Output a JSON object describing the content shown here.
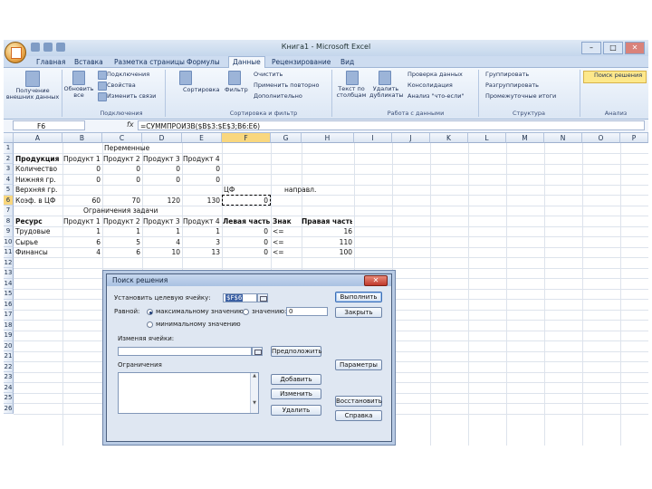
{
  "window": {
    "title": "Книга1 - Microsoft Excel"
  },
  "tabs": [
    "Главная",
    "Вставка",
    "Разметка страницы",
    "Формулы",
    "Данные",
    "Рецензирование",
    "Вид"
  ],
  "active_tab": "Данные",
  "ribbon": {
    "get_external": "Получение внешних данных",
    "refresh_all": "Обновить все",
    "connections": "Подключения",
    "properties": "Свойства",
    "edit_links": "Изменить связи",
    "group_connections": "Подключения",
    "sort": "Сортировка",
    "filter": "Фильтр",
    "clear": "Очистить",
    "reapply": "Применить повторно",
    "advanced": "Дополнительно",
    "group_sort": "Сортировка и фильтр",
    "text_to_columns": "Текст по столбцам",
    "remove_duplicates": "Удалить дубликаты",
    "data_validation": "Проверка данных",
    "consolidate": "Консолидация",
    "what_if": "Анализ \"что-если\"",
    "group_data_tools": "Работа с данными",
    "group": "Группировать",
    "ungroup": "Разгруппировать",
    "subtotal": "Промежуточные итоги",
    "group_outline": "Структура",
    "solver": "Поиск решения",
    "group_analysis": "Анализ"
  },
  "formula_bar": {
    "name_box": "F6",
    "fx": "fx",
    "formula": "=СУММПРОИЗВ($B$3:$E$3;B6:E6)"
  },
  "columns": [
    "A",
    "B",
    "C",
    "D",
    "E",
    "F",
    "G",
    "H",
    "I",
    "J",
    "K",
    "L",
    "M",
    "N",
    "O",
    "P"
  ],
  "rows": [
    "1",
    "2",
    "3",
    "4",
    "5",
    "6",
    "7",
    "8",
    "9",
    "10",
    "11",
    "12",
    "13",
    "14",
    "15",
    "16",
    "17",
    "18",
    "19",
    "20",
    "21",
    "22",
    "23",
    "24",
    "25",
    "26"
  ],
  "sheet": {
    "r1": {
      "b": "Переменные"
    },
    "r2": {
      "a": "Продукция",
      "b": "Продукт 1",
      "c": "Продукт 2",
      "d": "Продукт 3",
      "e": "Продукт 4"
    },
    "r3": {
      "a": "Количество",
      "b": "0",
      "c": "0",
      "d": "0",
      "e": "0"
    },
    "r4": {
      "a": "Нижняя гр.",
      "b": "0",
      "c": "0",
      "d": "0",
      "e": "0"
    },
    "r5": {
      "a": "Верхняя гр.",
      "f": "ЦФ",
      "g": "направл."
    },
    "r6": {
      "a": "Коэф. в ЦФ",
      "b": "60",
      "c": "70",
      "d": "120",
      "e": "130",
      "f": "0"
    },
    "r7": {
      "b": "Ограничения задачи"
    },
    "r8": {
      "a": "Ресурс",
      "b": "Продукт 1",
      "c": "Продукт 2",
      "d": "Продукт 3",
      "e": "Продукт 4",
      "f": "Левая часть",
      "g": "Знак",
      "h": "Правая часть"
    },
    "r9": {
      "a": "Трудовые",
      "b": "1",
      "c": "1",
      "d": "1",
      "e": "1",
      "f": "0",
      "g": "<=",
      "h": "16"
    },
    "r10": {
      "a": "Сырье",
      "b": "6",
      "c": "5",
      "d": "4",
      "e": "3",
      "f": "0",
      "g": "<=",
      "h": "110"
    },
    "r11": {
      "a": "Финансы",
      "b": "4",
      "c": "6",
      "d": "10",
      "e": "13",
      "f": "0",
      "g": "<=",
      "h": "100"
    }
  },
  "dialog": {
    "title": "Поиск решения",
    "close": "✕",
    "target_label": "Установить целевую ячейку:",
    "target_value": "$F$6",
    "equal_label": "Равной:",
    "opt_max": "максимальному значению",
    "opt_value": "значению:",
    "value_field": "0",
    "opt_min": "минимальному значению",
    "changing_label": "Изменяя ячейки:",
    "guess": "Предположить",
    "constraints_label": "Ограничения",
    "add": "Добавить",
    "change": "Изменить",
    "delete": "Удалить",
    "execute": "Выполнить",
    "close_btn": "Закрыть",
    "params": "Параметры",
    "restore": "Восстановить",
    "help": "Справка"
  }
}
